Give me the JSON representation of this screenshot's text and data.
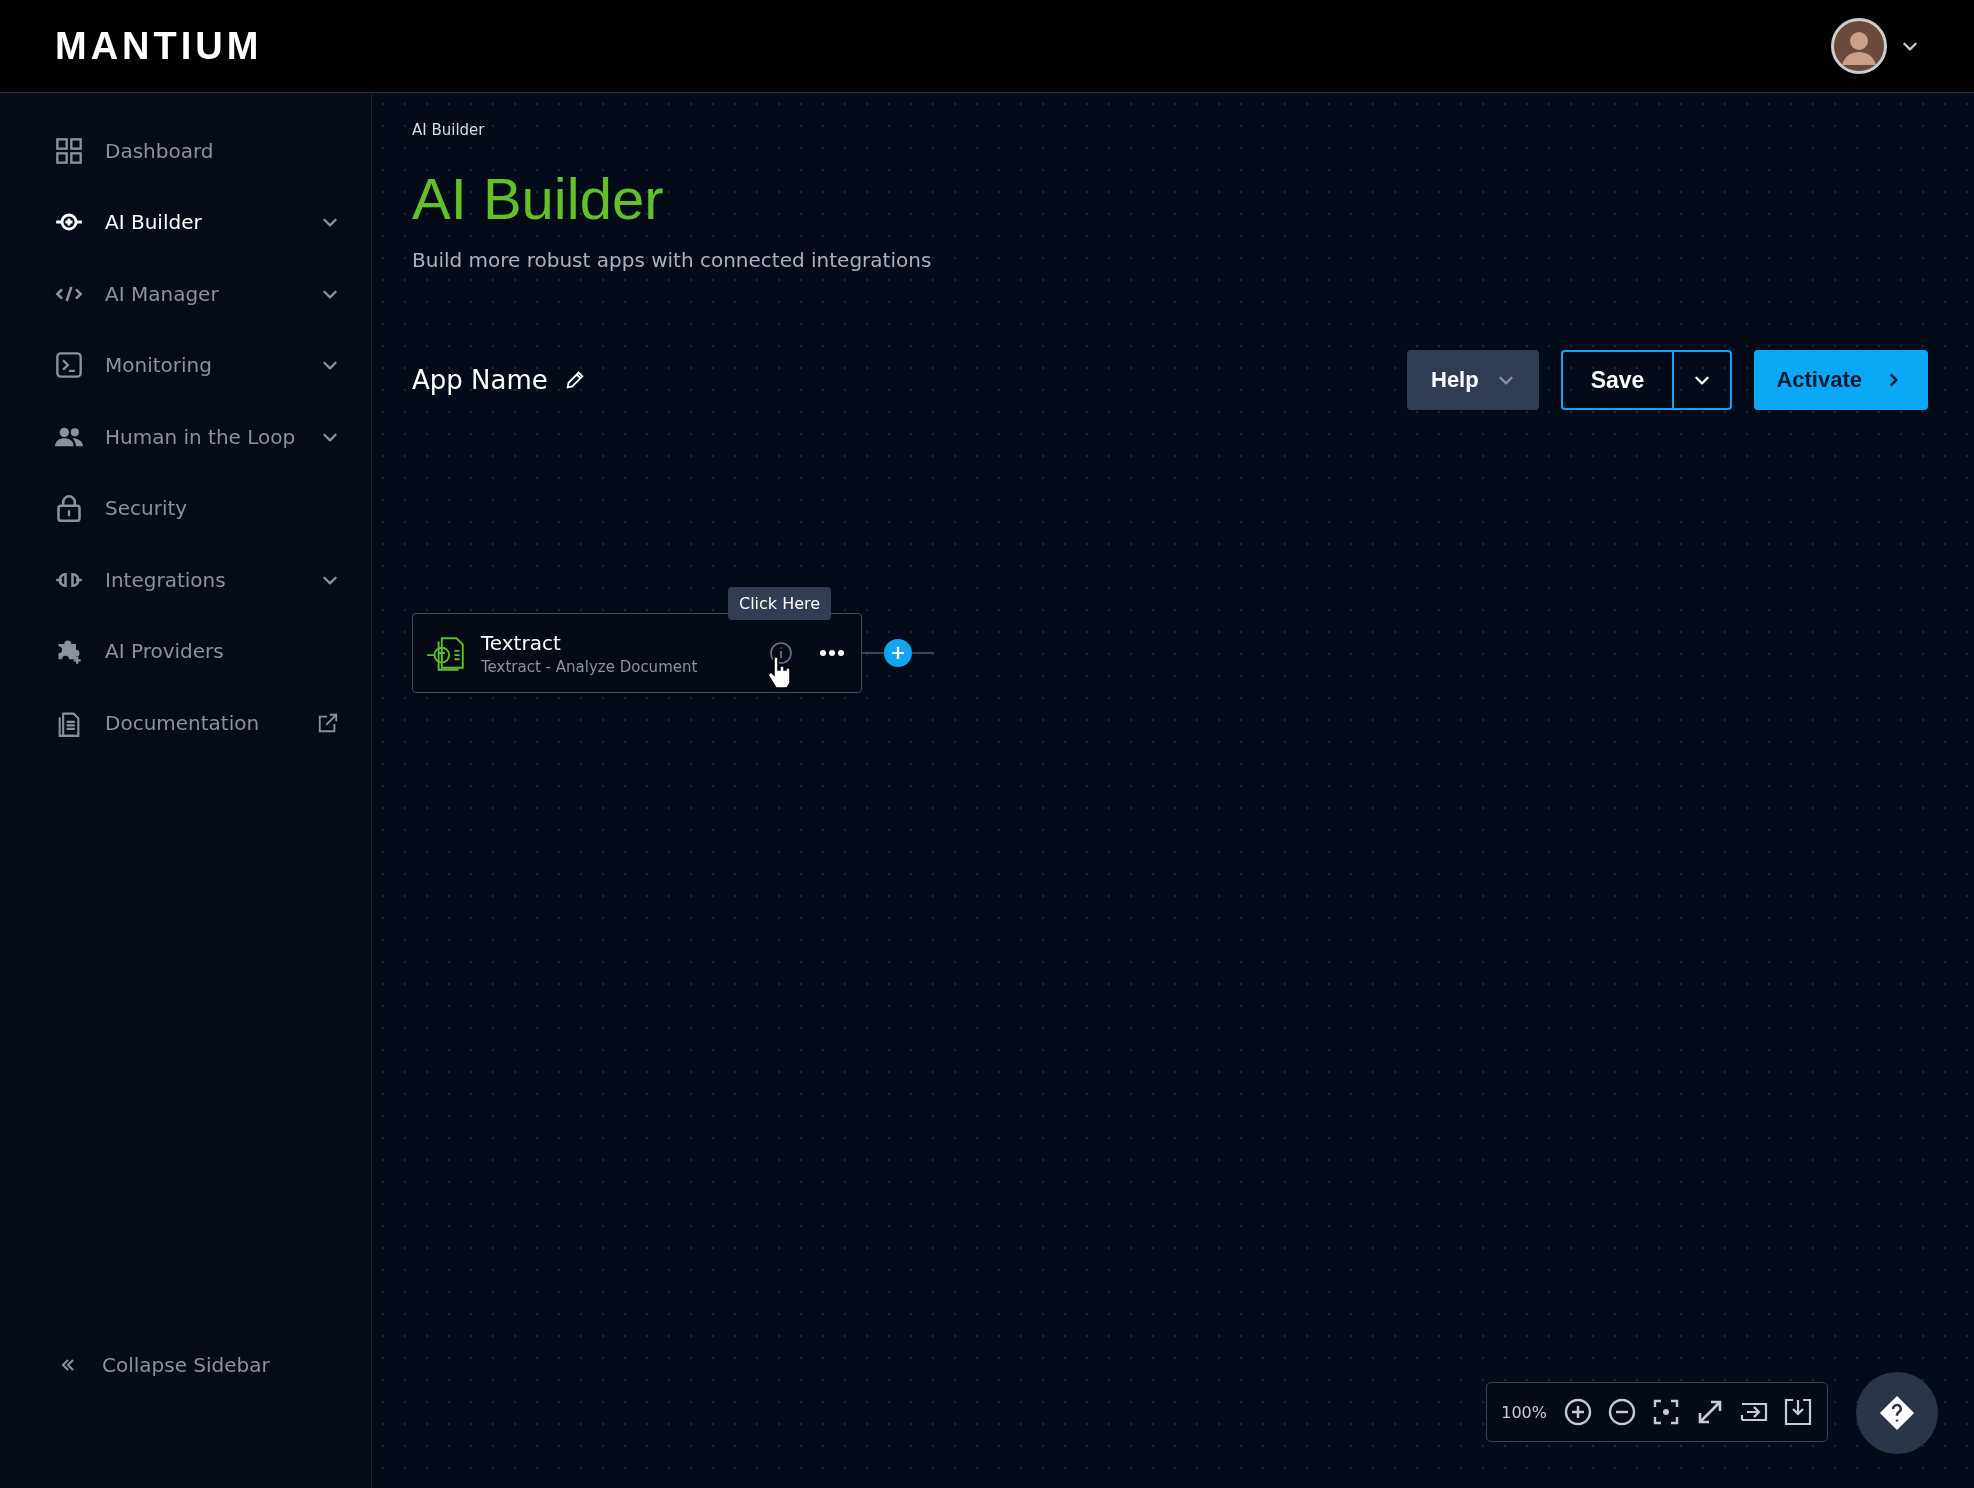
{
  "header": {
    "logo": "MANTIUM"
  },
  "sidebar": {
    "items": [
      {
        "label": "Dashboard",
        "selected": false,
        "expandable": false,
        "external": false
      },
      {
        "label": "AI Builder",
        "selected": true,
        "expandable": true,
        "external": false
      },
      {
        "label": "AI Manager",
        "selected": false,
        "expandable": true,
        "external": false
      },
      {
        "label": "Monitoring",
        "selected": false,
        "expandable": true,
        "external": false
      },
      {
        "label": "Human in the Loop",
        "selected": false,
        "expandable": true,
        "external": false
      },
      {
        "label": "Security",
        "selected": false,
        "expandable": false,
        "external": false
      },
      {
        "label": "Integrations",
        "selected": false,
        "expandable": true,
        "external": false
      },
      {
        "label": "AI Providers",
        "selected": false,
        "expandable": false,
        "external": false
      },
      {
        "label": "Documentation",
        "selected": false,
        "expandable": false,
        "external": true
      }
    ],
    "collapse": "Collapse Sidebar"
  },
  "breadcrumb": "AI Builder",
  "title": "AI Builder",
  "subtitle": "Build more robust apps with connected integrations",
  "app_name": "App Name",
  "buttons": {
    "help": "Help",
    "save": "Save",
    "activate": "Activate"
  },
  "node": {
    "title": "Textract",
    "subtitle": "Textract - Analyze Document",
    "tooltip": "Click Here"
  },
  "zoom": {
    "reading": "100%"
  }
}
